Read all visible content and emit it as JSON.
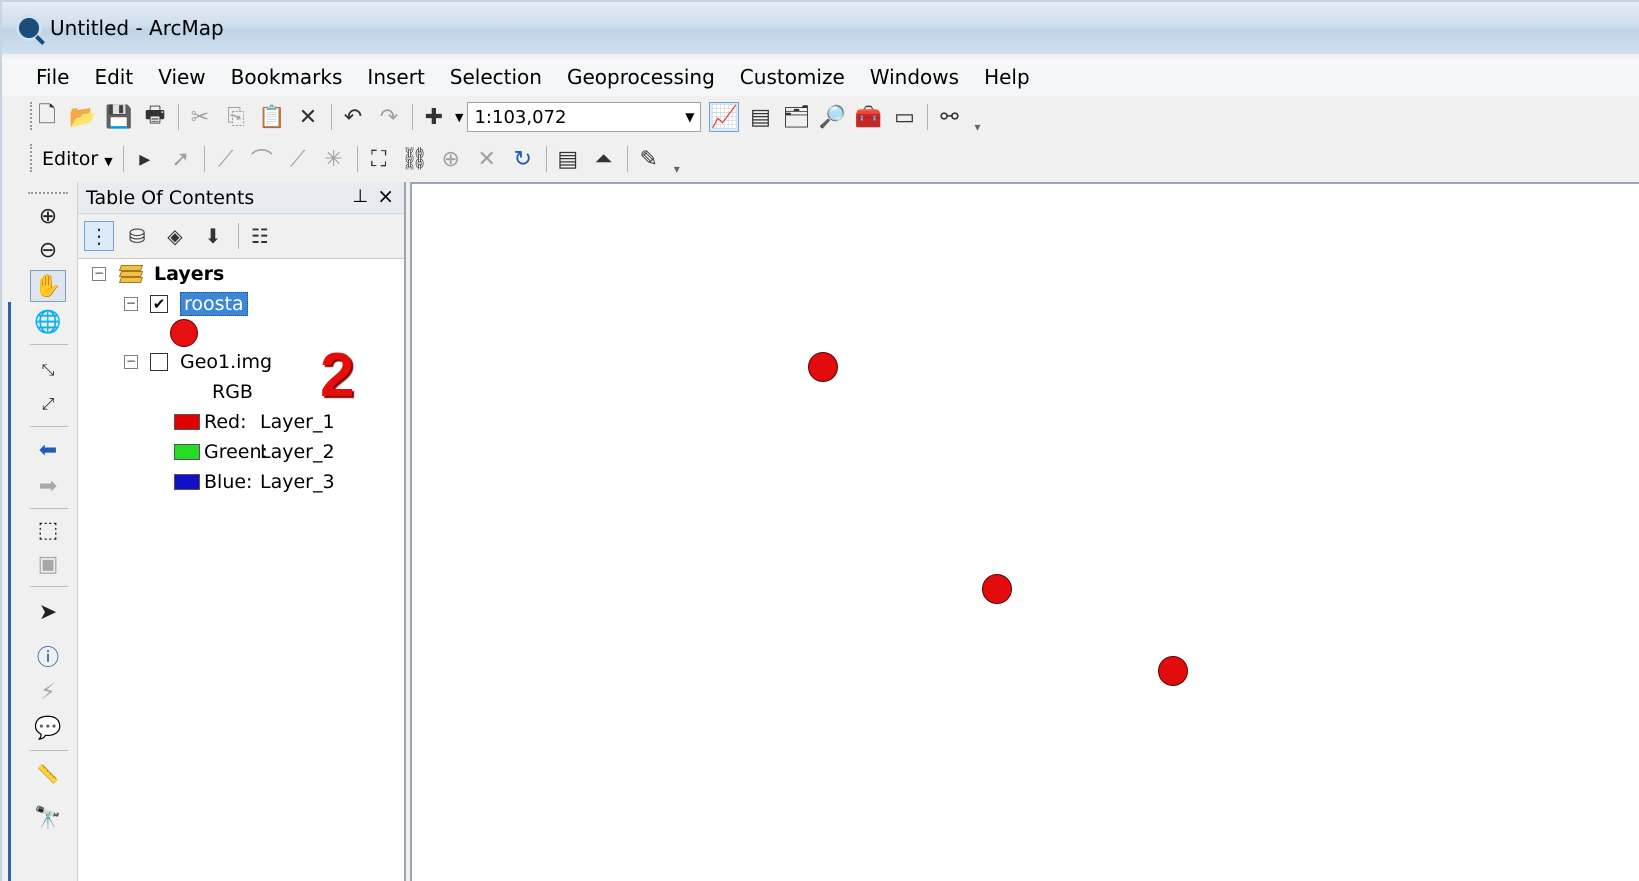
{
  "window": {
    "title": "Untitled - ArcMap"
  },
  "menu": [
    "File",
    "Edit",
    "View",
    "Bookmarks",
    "Insert",
    "Selection",
    "Geoprocessing",
    "Customize",
    "Windows",
    "Help"
  ],
  "standard_toolbar": {
    "scale": "1:103,072"
  },
  "editor_toolbar": {
    "editor_label": "Editor"
  },
  "toc": {
    "title": "Table Of Contents",
    "pin_glyph": "📌",
    "close_glyph": "×",
    "root": "Layers",
    "layers": [
      {
        "name": "roosta",
        "checked": true,
        "selected": true,
        "symbol_color": "#e61010"
      },
      {
        "name": "Geo1.img",
        "checked": false,
        "renderer": "RGB",
        "bands": [
          {
            "channel": "Red:",
            "layer": "Layer_1",
            "color": "#e00000"
          },
          {
            "channel": "Green:",
            "layer": "Layer_2",
            "color": "#22dd22"
          },
          {
            "channel": "Blue:",
            "layer": "Layer_3",
            "color": "#1010c8"
          }
        ]
      }
    ]
  },
  "annotation": "2",
  "map": {
    "point_color": "#e20c0c",
    "point_count": 3
  },
  "icons": {
    "tools": [
      "zoom-in-icon",
      "zoom-out-icon",
      "pan-icon",
      "full-extent-icon",
      "fixed-zoom-in-icon",
      "fixed-zoom-out-icon",
      "back-extent-icon",
      "forward-extent-icon",
      "select-features-icon",
      "clear-selection-icon",
      "select-elements-icon",
      "identify-icon",
      "hyperlink-icon",
      "html-popup-icon",
      "measure-icon",
      "find-icon"
    ]
  }
}
